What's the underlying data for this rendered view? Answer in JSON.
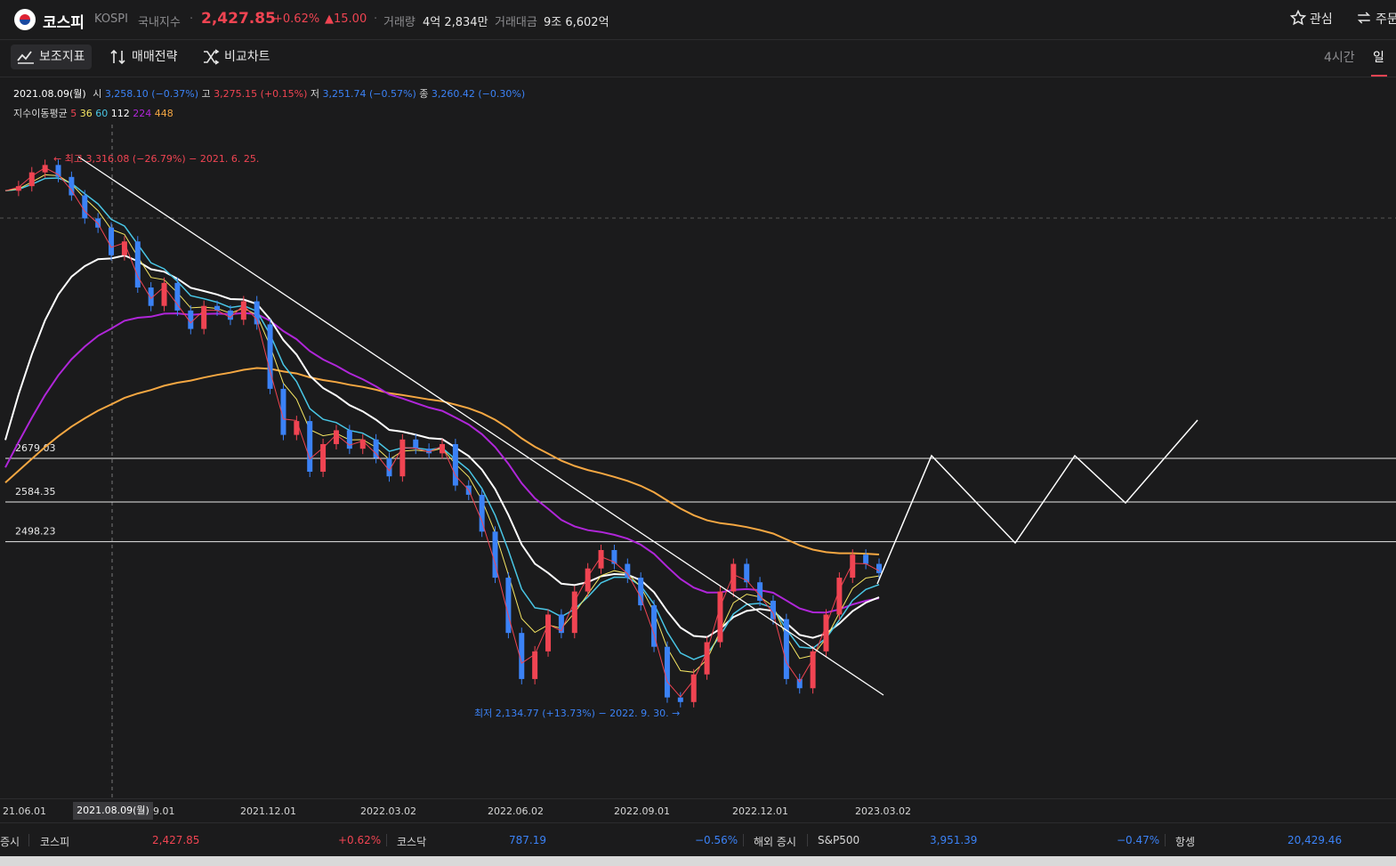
{
  "header": {
    "name": "코스피",
    "code": "KOSPI",
    "market": "국내지수",
    "separator": "·",
    "price": "2,427.85",
    "change_pct": "+0.62%",
    "change_abs": "▲15.00",
    "volume_label": "거래량",
    "volume_value": "4억 2,834만",
    "amount_label": "거래대금",
    "amount_value": "9조 6,602억",
    "favorite_label": "관심",
    "order_label": "주문"
  },
  "toolbar": {
    "indicators_label": "보조지표",
    "strategy_label": "매매전략",
    "compare_label": "비교차트",
    "timeframes": [
      "4시간",
      "일"
    ],
    "selected_timeframe": "일"
  },
  "ohlc": {
    "date": "2021.08.09(월)",
    "open_label": "시",
    "open": "3,258.10 (−0.37%)",
    "high_label": "고",
    "high": "3,275.15 (+0.15%)",
    "low_label": "저",
    "low": "3,251.74 (−0.57%)",
    "close_label": "종",
    "close": "3,260.42 (−0.30%)"
  },
  "ma": {
    "label": "지수이동평균",
    "periods": [
      {
        "value": "5",
        "color": "#f04452"
      },
      {
        "value": "36",
        "color": "#f5e663"
      },
      {
        "value": "60",
        "color": "#49c6e5"
      },
      {
        "value": "112",
        "color": "#ffffff"
      },
      {
        "value": "224",
        "color": "#b026d9"
      },
      {
        "value": "448",
        "color": "#f5a742"
      }
    ]
  },
  "chart_data": {
    "type": "line",
    "high_annotation": "← 최고 3,316.08 (−26.79%) − 2021. 6. 25.",
    "low_annotation": "최저 2,134.77 (+13.73%) − 2022. 9. 30. →",
    "levels": [
      "2679.03",
      "2584.35",
      "2498.23"
    ],
    "level_values": [
      2679.03,
      2584.35,
      2498.23
    ],
    "x_ticks": [
      "21.06.01",
      "9.01",
      "2021.12.01",
      "2022.03.02",
      "2022.06.02",
      "2022.09.01",
      "2022.12.01",
      "2023.03.02"
    ],
    "crosshair_date": "2021.08.09(월)",
    "price_path": [
      3260,
      3270,
      3300,
      3316,
      3290,
      3250,
      3200,
      3180,
      3120,
      3150,
      3050,
      3010,
      3060,
      3000,
      2960,
      3010,
      3000,
      2980,
      3020,
      2970,
      2830,
      2730,
      2760,
      2650,
      2710,
      2740,
      2700,
      2720,
      2680,
      2640,
      2720,
      2700,
      2690,
      2710,
      2620,
      2600,
      2520,
      2420,
      2300,
      2200,
      2260,
      2340,
      2300,
      2390,
      2440,
      2480,
      2450,
      2420,
      2360,
      2270,
      2160,
      2150,
      2210,
      2280,
      2390,
      2450,
      2410,
      2370,
      2330,
      2200,
      2180,
      2260,
      2340,
      2420,
      2470,
      2450,
      2430
    ],
    "ma_colors": {
      "ema5": "#f04452",
      "ema36": "#f5e663",
      "ema60": "#49c6e5",
      "ema112": "#ffffff",
      "ema224": "#b026d9",
      "ema448": "#f5a742"
    }
  },
  "bottom_bar": {
    "domestic_label": "증시",
    "kospi_label": "코스피",
    "kospi_value": "2,427.85",
    "kospi_pct": "+0.62%",
    "kosdaq_label": "코스닥",
    "kosdaq_value": "787.19",
    "kosdaq_pct": "−0.56%",
    "overseas_label": "해외 증시",
    "sp_label": "S&P500",
    "sp_value": "3,951.39",
    "sp_pct": "−0.47%",
    "hs_label": "항셍",
    "hs_value": "20,429.46"
  }
}
